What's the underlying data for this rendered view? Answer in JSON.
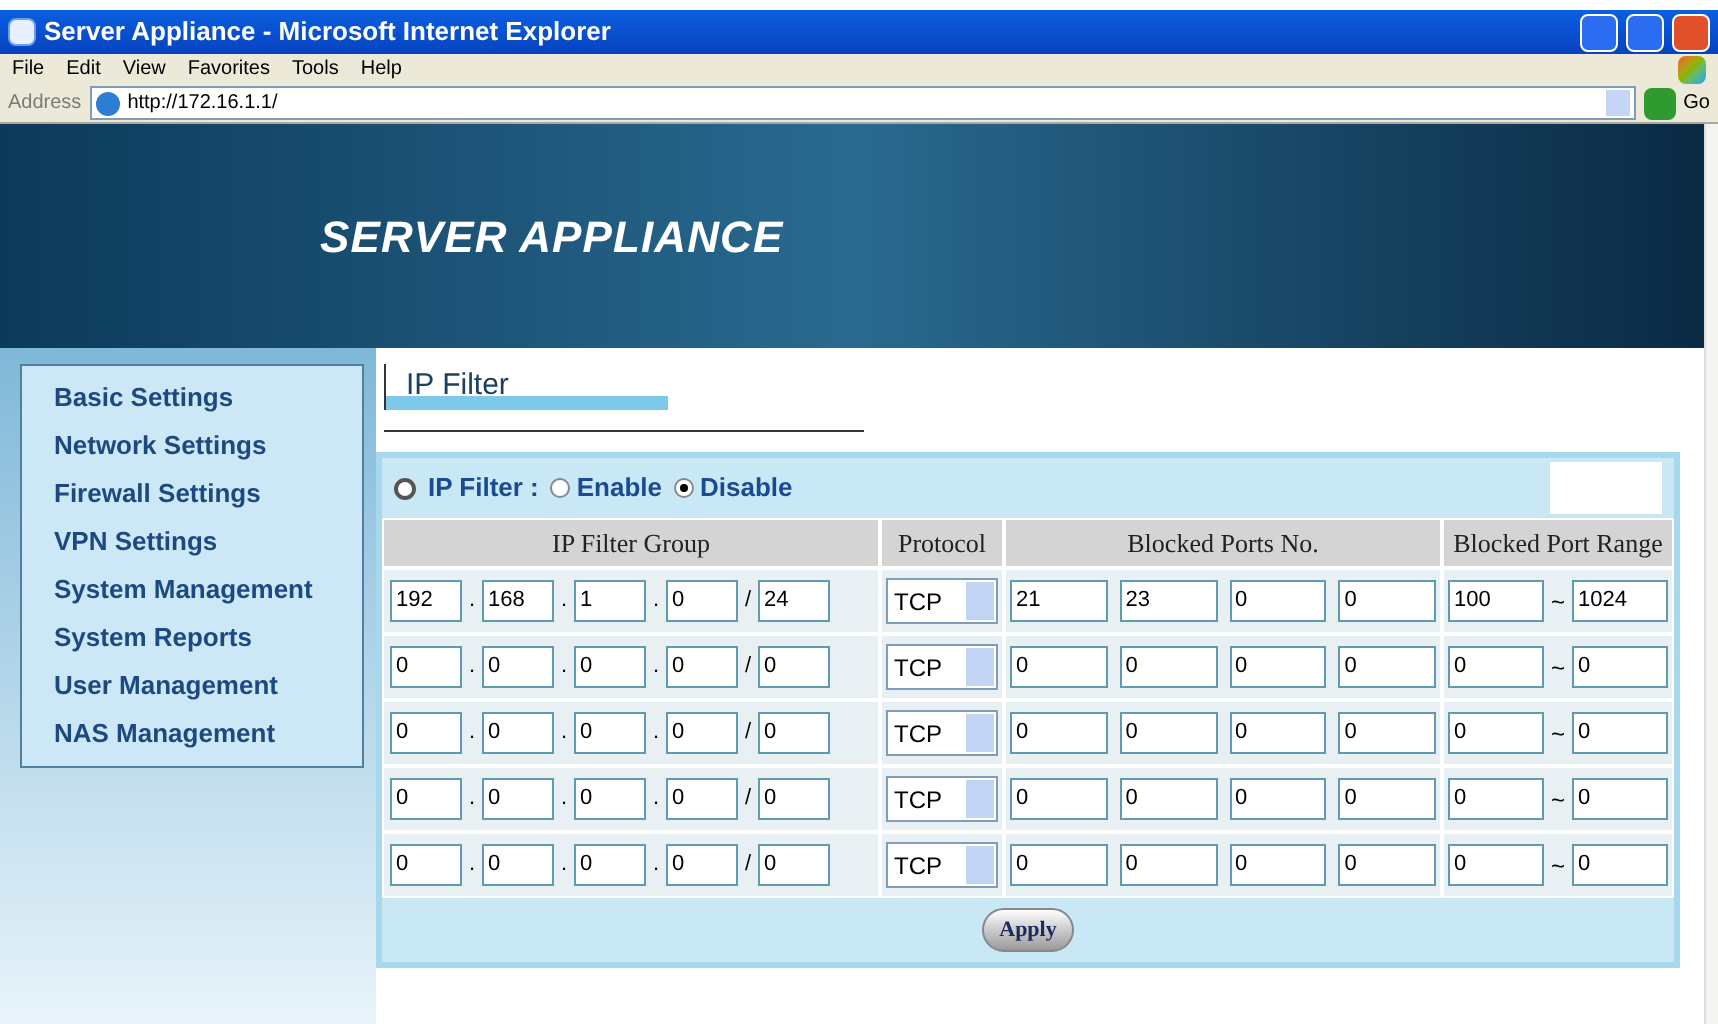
{
  "window": {
    "title": "Server Appliance - Microsoft Internet Explorer"
  },
  "menu": [
    "File",
    "Edit",
    "View",
    "Favorites",
    "Tools",
    "Help"
  ],
  "address": {
    "label": "Address",
    "url": "http://172.16.1.1/",
    "go": "Go"
  },
  "banner": {
    "title": "SERVER APPLIANCE"
  },
  "sidebar": {
    "items": [
      "Basic Settings",
      "Network Settings",
      "Firewall Settings",
      "VPN Settings",
      "System Management",
      "System Reports",
      "User Management",
      "NAS Management"
    ]
  },
  "page_title": "IP Filter",
  "ip_filter": {
    "label": "IP Filter :",
    "options": [
      {
        "label": "Enable",
        "selected": false
      },
      {
        "label": "Disable",
        "selected": true
      }
    ]
  },
  "table": {
    "columns": [
      "IP Filter Group",
      "Protocol",
      "Blocked Ports No.",
      "Blocked Port Range"
    ],
    "rows": [
      {
        "ip": [
          "192",
          "168",
          "1",
          "0"
        ],
        "separators": [
          ".",
          ".",
          ".",
          "/"
        ],
        "mask": "24",
        "protocol": "TCP",
        "ports": [
          "21",
          "23",
          "0",
          "0"
        ],
        "range_start": "100",
        "range_separator": "~",
        "range_end": "1024"
      },
      {
        "ip": [
          "0",
          "0",
          "0",
          "0"
        ],
        "separators": [
          ".",
          ".",
          ".",
          "/"
        ],
        "mask": "0",
        "protocol": "TCP",
        "ports": [
          "0",
          "0",
          "0",
          "0"
        ],
        "range_start": "0",
        "range_separator": "~",
        "range_end": "0"
      },
      {
        "ip": [
          "0",
          "0",
          "0",
          "0"
        ],
        "separators": [
          ".",
          ".",
          ".",
          "/"
        ],
        "mask": "0",
        "protocol": "TCP",
        "ports": [
          "0",
          "0",
          "0",
          "0"
        ],
        "range_start": "0",
        "range_separator": "~",
        "range_end": "0"
      },
      {
        "ip": [
          "0",
          "0",
          "0",
          "0"
        ],
        "separators": [
          ".",
          ".",
          ".",
          "/"
        ],
        "mask": "0",
        "protocol": "TCP",
        "ports": [
          "0",
          "0",
          "0",
          "0"
        ],
        "range_start": "0",
        "range_separator": "~",
        "range_end": "0"
      },
      {
        "ip": [
          "0",
          "0",
          "0",
          "0"
        ],
        "separators": [
          ".",
          ".",
          ".",
          "/"
        ],
        "mask": "0",
        "protocol": "TCP",
        "ports": [
          "0",
          "0",
          "0",
          "0"
        ],
        "range_start": "0",
        "range_separator": "~",
        "range_end": "0"
      }
    ]
  },
  "apply": "Apply"
}
